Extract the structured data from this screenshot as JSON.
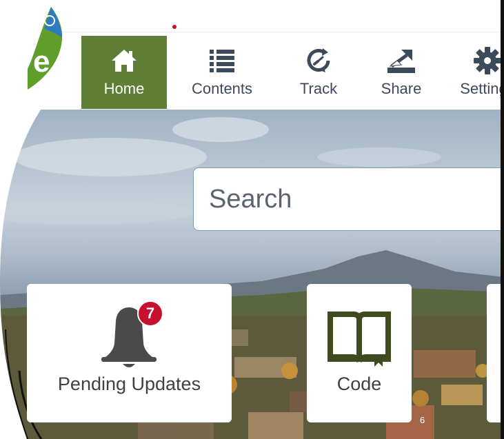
{
  "nav": {
    "items": [
      {
        "label": "Home",
        "icon": "home-icon"
      },
      {
        "label": "Contents",
        "icon": "list-icon"
      },
      {
        "label": "Track",
        "icon": "track-icon"
      },
      {
        "label": "Share",
        "icon": "share-icon"
      },
      {
        "label": "Settings",
        "icon": "gear-icon"
      }
    ],
    "active": "Home"
  },
  "search": {
    "placeholder": "Search"
  },
  "tiles": [
    {
      "label": "Pending Updates",
      "icon": "bell-icon",
      "badge": "7"
    },
    {
      "label": "Code",
      "icon": "book-icon"
    }
  ],
  "slide": {
    "page_number": "6"
  },
  "colors": {
    "accent": "#5d7e34",
    "badge": "#c8102e",
    "nav_text": "#3d4a5c",
    "icon_dark": "#3d4a5c",
    "code_icon": "#3f4a1f"
  }
}
